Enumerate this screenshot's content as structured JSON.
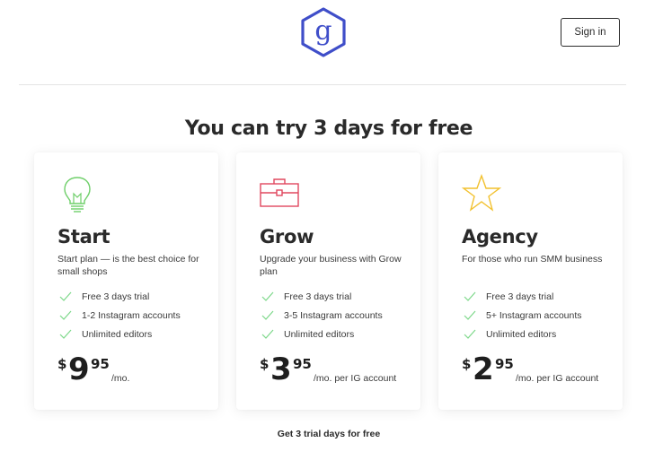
{
  "header": {
    "logo_letter": "g",
    "sign_in_label": "Sign in"
  },
  "headline": "You can try 3 days for free",
  "colors": {
    "brand": "#3f4ec9",
    "check": "#7dd88a",
    "start_icon": "#6fcf6a",
    "grow_icon": "#e0485f",
    "agency_icon": "#f2c12e"
  },
  "plans": [
    {
      "icon": "lightbulb-icon",
      "name": "Start",
      "description": "Start plan — is the best choice for small shops",
      "features": [
        "Free 3 days trial",
        "1-2 Instagram accounts",
        "Unlimited editors"
      ],
      "price": {
        "currency": "$",
        "amount": "9",
        "cents": "95",
        "period": "/mo."
      }
    },
    {
      "icon": "briefcase-icon",
      "name": "Grow",
      "description": "Upgrade your business with Grow plan",
      "features": [
        "Free 3 days trial",
        "3-5 Instagram accounts",
        "Unlimited editors"
      ],
      "price": {
        "currency": "$",
        "amount": "3",
        "cents": "95",
        "period": "/mo. per IG account"
      }
    },
    {
      "icon": "star-icon",
      "name": "Agency",
      "description": "For those who run SMM business",
      "features": [
        "Free 3 days trial",
        "5+ Instagram accounts",
        "Unlimited editors"
      ],
      "price": {
        "currency": "$",
        "amount": "2",
        "cents": "95",
        "period": "/mo. per IG account"
      }
    }
  ],
  "cta": "Get 3 trial days for free"
}
